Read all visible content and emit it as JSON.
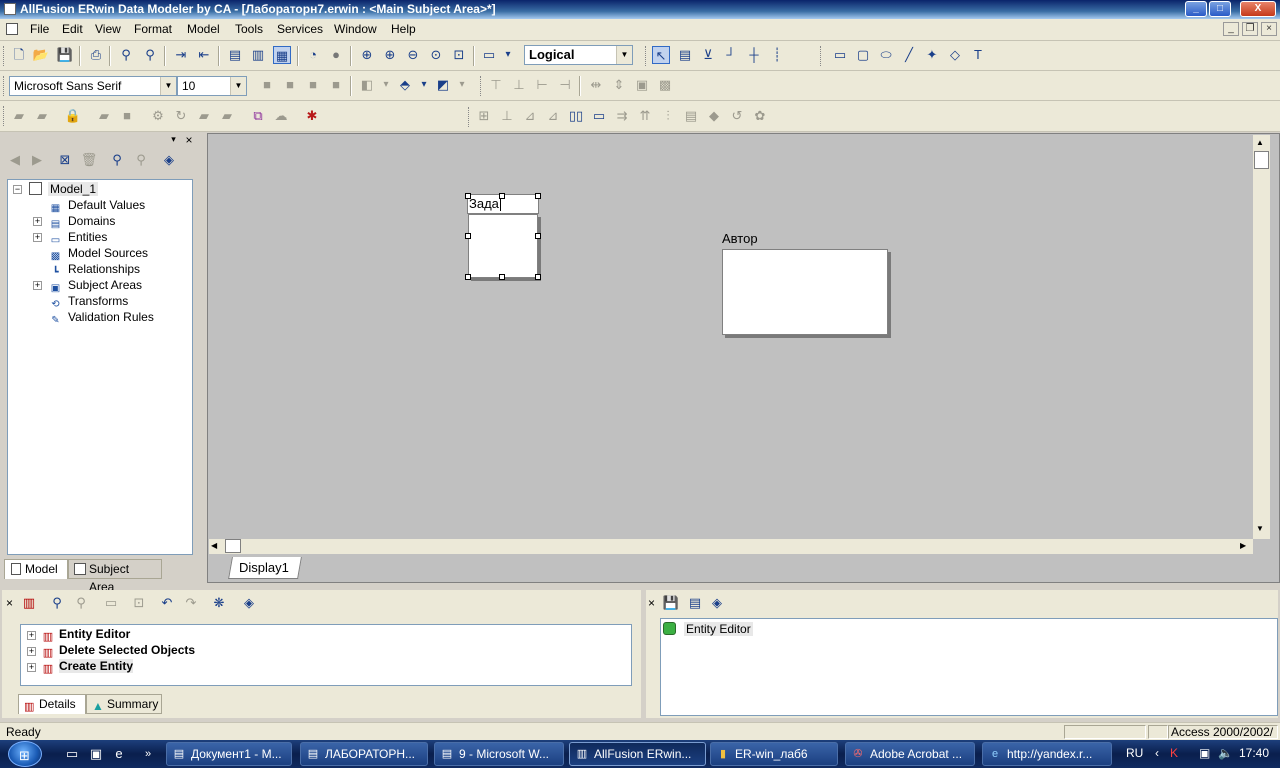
{
  "window": {
    "title": "AllFusion ERwin Data Modeler by CA - [Лабораторн7.erwin : <Main Subject Area>*]",
    "minimize_label": "_",
    "maximize_label": "□",
    "close_label": "X"
  },
  "menu": {
    "items": [
      "File",
      "Edit",
      "View",
      "Format",
      "Model",
      "Tools",
      "Services",
      "Window",
      "Help"
    ]
  },
  "toolbar": {
    "view_level": "Logical",
    "font_name": "Microsoft Sans Serif",
    "font_size": "10"
  },
  "left_panel": {
    "tree": {
      "root": "Model_1",
      "children": [
        {
          "label": "Default Values",
          "expandable": false
        },
        {
          "label": "Domains",
          "expandable": true
        },
        {
          "label": "Entities",
          "expandable": true
        },
        {
          "label": "Model Sources",
          "expandable": false
        },
        {
          "label": "Relationships",
          "expandable": false
        },
        {
          "label": "Subject Areas",
          "expandable": true
        },
        {
          "label": "Transforms",
          "expandable": false
        },
        {
          "label": "Validation Rules",
          "expandable": false
        }
      ]
    },
    "tabs": [
      "Model",
      "Subject Area"
    ]
  },
  "diagram": {
    "entities": [
      {
        "name": "Зада",
        "editing": true,
        "selected": true
      },
      {
        "name": "Автор",
        "editing": false,
        "selected": false
      }
    ],
    "display_tab": "Display1"
  },
  "action_log": {
    "items": [
      "Entity Editor",
      "Delete Selected Objects",
      "Create Entity"
    ],
    "tabs": [
      "Details",
      "Summary"
    ]
  },
  "undo_panel": {
    "items": [
      "Entity Editor"
    ]
  },
  "statusbar": {
    "status": "Ready",
    "db": "Access 2000/2002/"
  },
  "taskbar": {
    "buttons": [
      {
        "label": "Документ1 - M...",
        "active": false
      },
      {
        "label": "ЛАБОРАТОРН...",
        "active": false
      },
      {
        "label": "9 - Microsoft W...",
        "active": false
      },
      {
        "label": "AllFusion ERwin...",
        "active": true
      },
      {
        "label": "ER-win_лаб6",
        "active": false
      },
      {
        "label": "Adobe Acrobat ...",
        "active": false
      },
      {
        "label": "http://yandex.r...",
        "active": false
      }
    ],
    "language": "RU",
    "clock": "17:40"
  }
}
